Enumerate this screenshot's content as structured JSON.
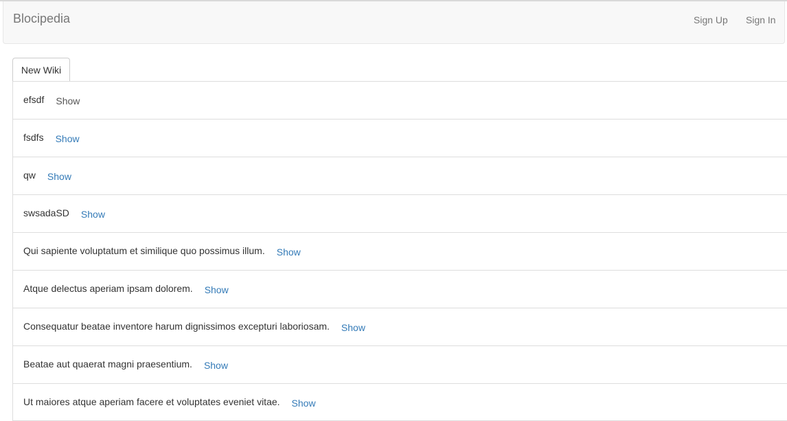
{
  "navbar": {
    "brand": "Blocipedia",
    "sign_up": "Sign Up",
    "sign_in": "Sign In"
  },
  "toolbar": {
    "new_wiki_label": "New Wiki"
  },
  "wikis": [
    {
      "title": "efsdf",
      "action": "Show"
    },
    {
      "title": "fsdfs",
      "action": "Show"
    },
    {
      "title": "qw",
      "action": "Show"
    },
    {
      "title": "swsadaSD",
      "action": "Show"
    },
    {
      "title": "Qui sapiente voluptatum et similique quo possimus illum.",
      "action": "Show"
    },
    {
      "title": "Atque delectus aperiam ipsam dolorem.",
      "action": "Show"
    },
    {
      "title": "Consequatur beatae inventore harum dignissimos excepturi laboriosam.",
      "action": "Show"
    },
    {
      "title": "Beatae aut quaerat magni praesentium.",
      "action": "Show"
    },
    {
      "title": "Ut maiores atque aperiam facere et voluptates eveniet vitae.",
      "action": "Show"
    }
  ],
  "colors": {
    "link": "#337ab7",
    "navbar_bg": "#f8f8f8",
    "border": "#dddddd"
  }
}
